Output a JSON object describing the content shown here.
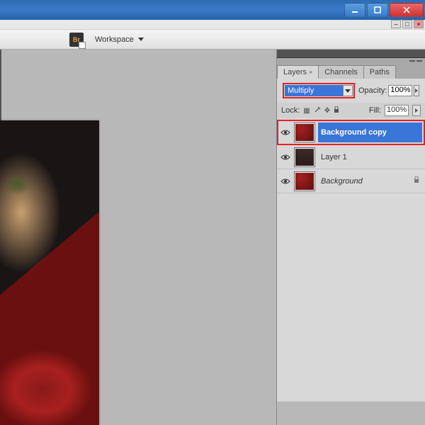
{
  "toolbar": {
    "bridge_icon": "Br",
    "workspace_label": "Workspace"
  },
  "panel": {
    "tabs": [
      {
        "label": "Layers",
        "active": true
      },
      {
        "label": "Channels",
        "active": false
      },
      {
        "label": "Paths",
        "active": false
      }
    ],
    "blend_mode": "Multiply",
    "opacity_label": "Opacity:",
    "opacity_value": "100%",
    "lock_label": "Lock:",
    "fill_label": "Fill:",
    "fill_value": "100%",
    "layers": [
      {
        "name": "Background copy",
        "visible": true,
        "selected": true,
        "highlighted": true,
        "thumb": "red",
        "locked": false
      },
      {
        "name": "Layer 1",
        "visible": true,
        "selected": false,
        "highlighted": false,
        "thumb": "dark",
        "locked": false
      },
      {
        "name": "Background",
        "visible": true,
        "selected": false,
        "highlighted": false,
        "thumb": "red",
        "locked": true,
        "italic": true
      }
    ]
  }
}
